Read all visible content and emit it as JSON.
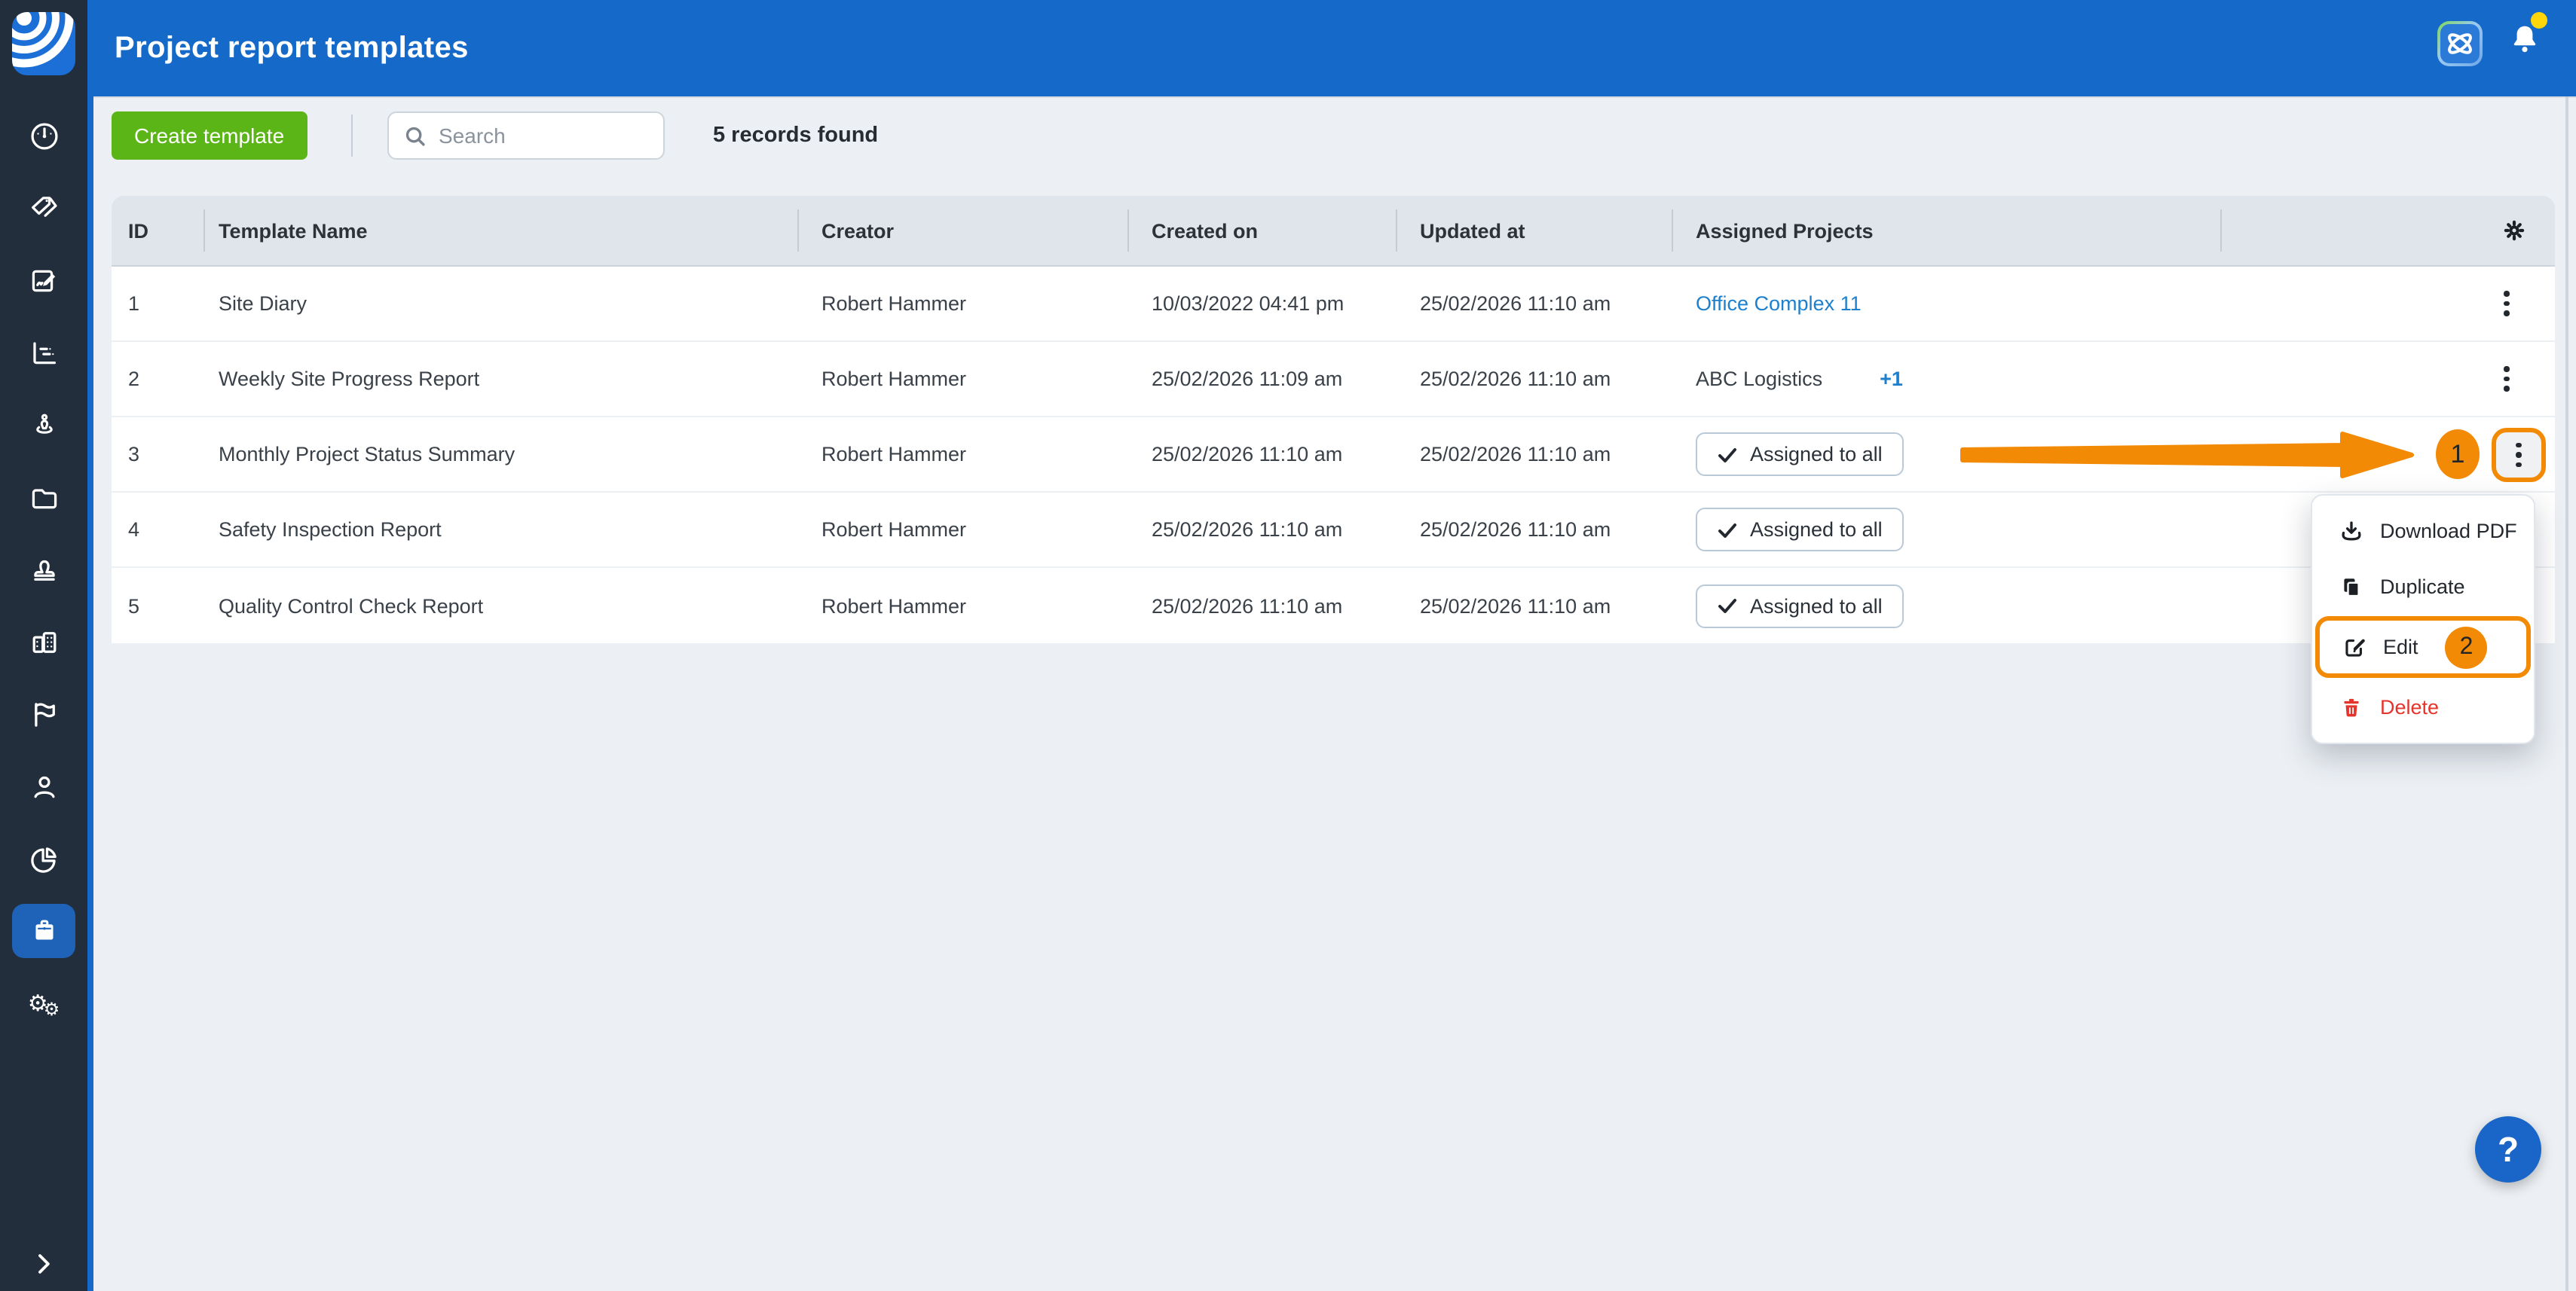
{
  "topbar": {
    "title": "Project report templates",
    "appswitcher_icon": "app-switcher-icon",
    "notification_icon": "bell-icon",
    "notification_badge_color": "#FFD60A"
  },
  "sidebar": {
    "logo_icon": "brand-logo",
    "items": [
      {
        "icon": "dashboard-icon"
      },
      {
        "icon": "tags-icon"
      },
      {
        "icon": "forms-signature-icon"
      },
      {
        "icon": "gantt-chart-icon"
      },
      {
        "icon": "surveyor-icon"
      },
      {
        "icon": "projects-folder-icon"
      },
      {
        "icon": "approvals-stamp-icon"
      },
      {
        "icon": "company-buildings-icon"
      },
      {
        "icon": "tickets-flag-icon"
      },
      {
        "icon": "contacts-user-icon"
      },
      {
        "icon": "statistics-pie-icon"
      },
      {
        "icon": "reports-clipboard-icon",
        "active": true
      },
      {
        "icon": "settings-gears-icon"
      }
    ],
    "expand_icon": "chevron-right-icon"
  },
  "toolbar": {
    "create_label": "Create template",
    "search_placeholder": "Search",
    "records_found": "5 records found"
  },
  "table": {
    "columns": [
      "ID",
      "Template Name",
      "Creator",
      "Created on",
      "Updated at",
      "Assigned Projects"
    ],
    "settings_icon": "gear-icon",
    "row_menu_icon": "kebab-icon",
    "rows": [
      {
        "id": "1",
        "name": "Site Diary",
        "creator": "Robert Hammer",
        "created": "10/03/2022 04:41 pm",
        "updated": "25/02/2026 11:10 am",
        "assigned": "Office Complex 11"
      },
      {
        "id": "2",
        "name": "Weekly Site Progress Report",
        "creator": "Robert Hammer",
        "created": "25/02/2026 11:09 am",
        "updated": "25/02/2026 11:10 am",
        "assigned": "ABC Logistics",
        "assigned_extra": "+1"
      },
      {
        "id": "3",
        "name": "Monthly Project Status Summary",
        "creator": "Robert Hammer",
        "created": "25/02/2026 11:10 am",
        "updated": "25/02/2026 11:10 am",
        "assigned": "Assigned to all"
      },
      {
        "id": "4",
        "name": "Safety Inspection Report",
        "creator": "Robert Hammer",
        "created": "25/02/2026 11:10 am",
        "updated": "25/02/2026 11:10 am",
        "assigned": "Assigned to all"
      },
      {
        "id": "5",
        "name": "Quality Control Check Report",
        "creator": "Robert Hammer",
        "created": "25/02/2026 11:10 am",
        "updated": "25/02/2026 11:10 am",
        "assigned": "Assigned to all"
      }
    ]
  },
  "context_menu": {
    "items": [
      {
        "label": "Download PDF",
        "icon": "download-icon"
      },
      {
        "label": "Duplicate",
        "icon": "duplicate-icon"
      },
      {
        "label": "Edit",
        "icon": "edit-icon",
        "highlighted": true
      },
      {
        "label": "Delete",
        "icon": "delete-icon",
        "danger": true
      }
    ]
  },
  "annotations": {
    "step1_label": "1",
    "step2_label": "2"
  },
  "help_button": {
    "label": "?"
  },
  "colors": {
    "topbar_blue": "#1569C9",
    "sidebar_dark": "#232E3C",
    "active_item_blue": "#1E63B8",
    "accent_orange": "#F28A05",
    "create_green": "#5CB516",
    "danger_red": "#E5342B",
    "link_blue": "#1E80CC",
    "header_grey": "#DFE5EA",
    "page_bg": "#ECF0F4"
  }
}
